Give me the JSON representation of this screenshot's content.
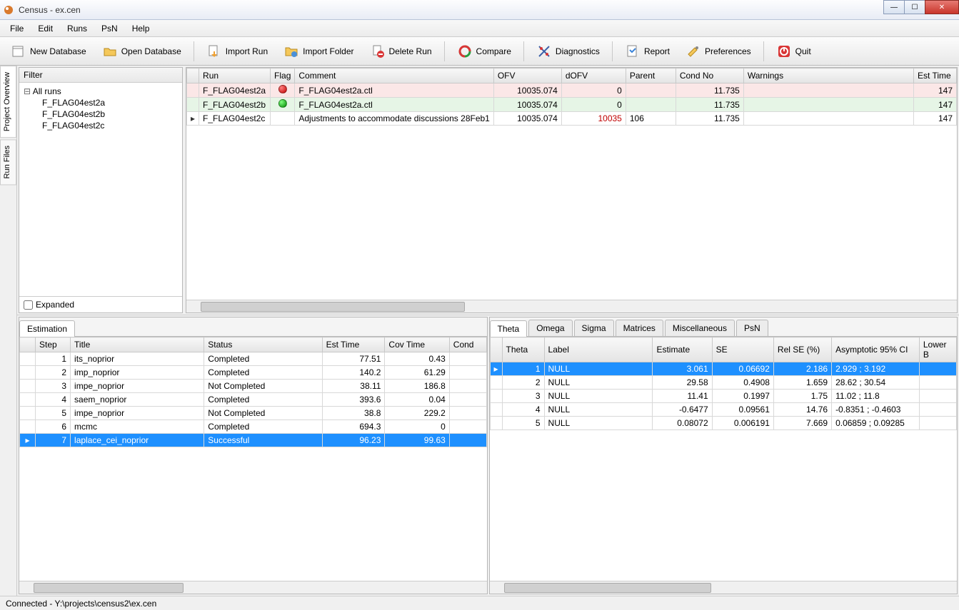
{
  "window": {
    "title": "Census - ex.cen"
  },
  "menu": {
    "items": [
      "File",
      "Edit",
      "Runs",
      "PsN",
      "Help"
    ]
  },
  "toolbar": {
    "new_db": "New Database",
    "open_db": "Open Database",
    "import_run": "Import Run",
    "import_folder": "Import Folder",
    "delete_run": "Delete Run",
    "compare": "Compare",
    "diagnostics": "Diagnostics",
    "report": "Report",
    "preferences": "Preferences",
    "quit": "Quit"
  },
  "side_tabs": {
    "overview": "Project Overview",
    "files": "Run Files"
  },
  "filter": {
    "header": "Filter",
    "root": "All runs",
    "children": [
      "F_FLAG04est2a",
      "F_FLAG04est2b",
      "F_FLAG04est2c"
    ],
    "expanded_label": "Expanded"
  },
  "runs_grid": {
    "cols": [
      "",
      "Run",
      "Flag",
      "Comment",
      "OFV",
      "dOFV",
      "Parent",
      "Cond No",
      "Warnings",
      "Est Time"
    ],
    "rows": [
      {
        "marker": "",
        "run": "F_FLAG04est2a",
        "flag": "red",
        "comment": "F_FLAG04est2a.ctl",
        "ofv": "10035.074",
        "dofv": "0",
        "dofv_red": false,
        "parent": "",
        "cond": "11.735",
        "warn": "",
        "est": "147",
        "rowclass": "row-red"
      },
      {
        "marker": "",
        "run": "F_FLAG04est2b",
        "flag": "green",
        "comment": "F_FLAG04est2a.ctl",
        "ofv": "10035.074",
        "dofv": "0",
        "dofv_red": false,
        "parent": "",
        "cond": "11.735",
        "warn": "",
        "est": "147",
        "rowclass": "row-green"
      },
      {
        "marker": "▸",
        "run": "F_FLAG04est2c",
        "flag": "",
        "comment": "Adjustments to accommodate discussions 28Feb1",
        "ofv": "10035.074",
        "dofv": "10035",
        "dofv_red": true,
        "parent": "106",
        "cond": "11.735",
        "warn": "",
        "est": "147",
        "rowclass": ""
      }
    ]
  },
  "estimation": {
    "tab": "Estimation",
    "cols": [
      "",
      "Step",
      "Title",
      "Status",
      "Est Time",
      "Cov Time",
      "Cond"
    ],
    "rows": [
      {
        "m": "",
        "step": "1",
        "title": "its_noprior",
        "status": "Completed",
        "est": "77.51",
        "cov": "0.43",
        "cond": "",
        "sel": false
      },
      {
        "m": "",
        "step": "2",
        "title": "imp_noprior",
        "status": "Completed",
        "est": "140.2",
        "cov": "61.29",
        "cond": "",
        "sel": false
      },
      {
        "m": "",
        "step": "3",
        "title": "impe_noprior",
        "status": "Not Completed",
        "est": "38.11",
        "cov": "186.8",
        "cond": "",
        "sel": false
      },
      {
        "m": "",
        "step": "4",
        "title": "saem_noprior",
        "status": "Completed",
        "est": "393.6",
        "cov": "0.04",
        "cond": "",
        "sel": false
      },
      {
        "m": "",
        "step": "5",
        "title": "impe_noprior",
        "status": "Not Completed",
        "est": "38.8",
        "cov": "229.2",
        "cond": "",
        "sel": false
      },
      {
        "m": "",
        "step": "6",
        "title": "mcmc",
        "status": "Completed",
        "est": "694.3",
        "cov": "0",
        "cond": "",
        "sel": false
      },
      {
        "m": "▸",
        "step": "7",
        "title": "laplace_cei_noprior",
        "status": "Successful",
        "est": "96.23",
        "cov": "99.63",
        "cond": "",
        "sel": true
      }
    ]
  },
  "results": {
    "tabs": [
      "Theta",
      "Omega",
      "Sigma",
      "Matrices",
      "Miscellaneous",
      "PsN"
    ],
    "cols": [
      "",
      "Theta",
      "Label",
      "Estimate",
      "SE",
      "Rel SE (%)",
      "Asymptotic 95% CI",
      "Lower B"
    ],
    "rows": [
      {
        "m": "▸",
        "theta": "1",
        "label": "NULL",
        "est": "3.061",
        "se": "0.06692",
        "rse": "2.186",
        "ci": "2.929 ; 3.192",
        "lb": "",
        "sel": true
      },
      {
        "m": "",
        "theta": "2",
        "label": "NULL",
        "est": "29.58",
        "se": "0.4908",
        "rse": "1.659",
        "ci": "28.62 ; 30.54",
        "lb": "",
        "sel": false
      },
      {
        "m": "",
        "theta": "3",
        "label": "NULL",
        "est": "11.41",
        "se": "0.1997",
        "rse": "1.75",
        "ci": "11.02 ; 11.8",
        "lb": "",
        "sel": false
      },
      {
        "m": "",
        "theta": "4",
        "label": "NULL",
        "est": "-0.6477",
        "se": "0.09561",
        "rse": "14.76",
        "ci": "-0.8351 ; -0.4603",
        "lb": "",
        "sel": false
      },
      {
        "m": "",
        "theta": "5",
        "label": "NULL",
        "est": "0.08072",
        "se": "0.006191",
        "rse": "7.669",
        "ci": "0.06859 ; 0.09285",
        "lb": "",
        "sel": false
      }
    ]
  },
  "status": "Connected - Y:\\projects\\census2\\ex.cen"
}
